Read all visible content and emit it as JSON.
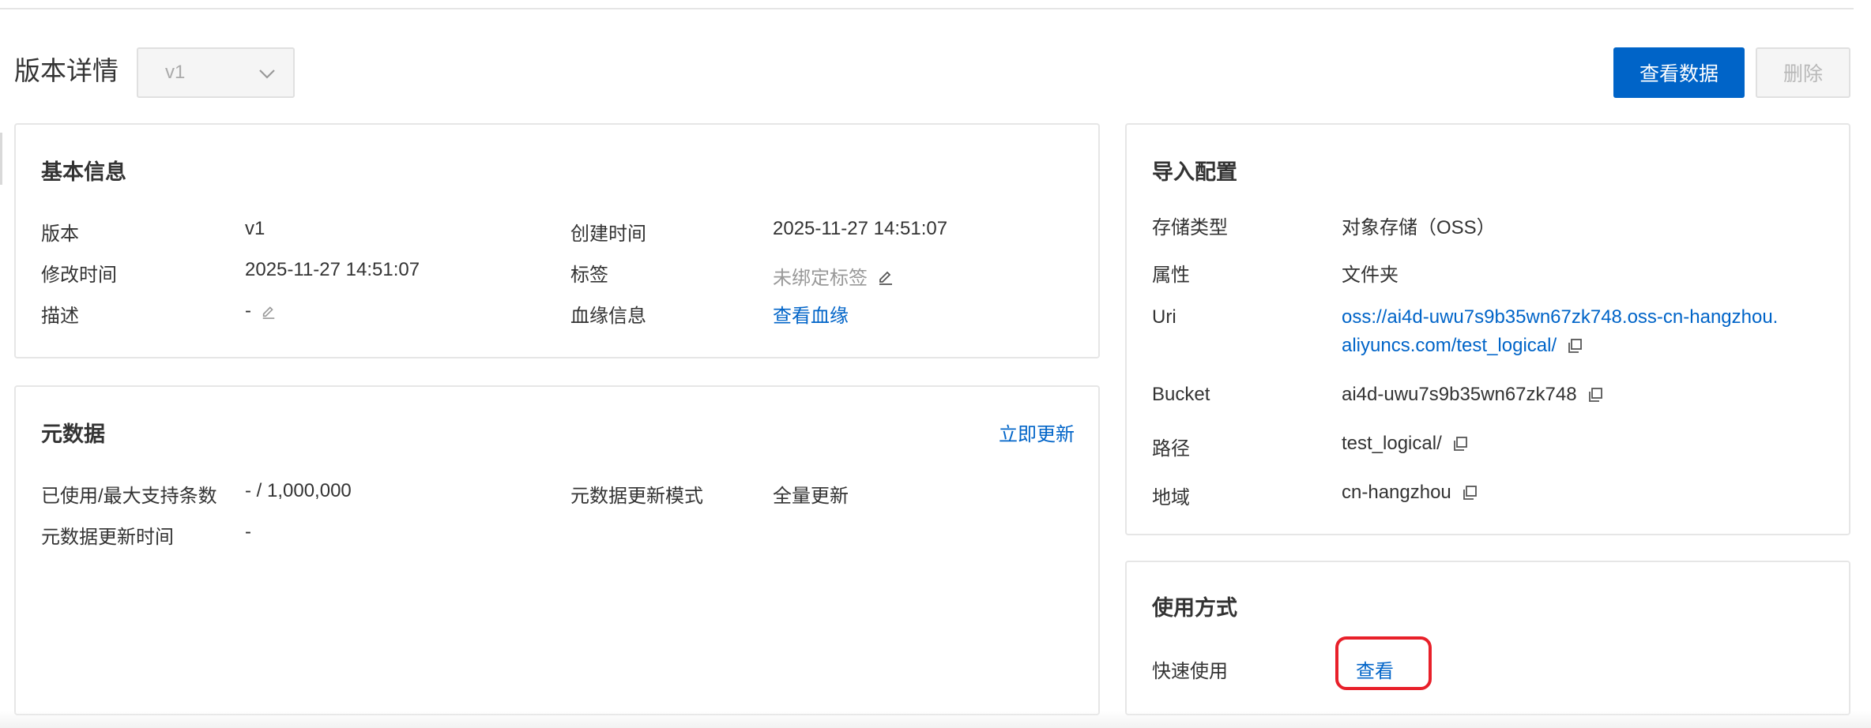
{
  "header": {
    "title": "版本详情",
    "version_selected": "v1",
    "view_data_label": "查看数据",
    "delete_label": "删除"
  },
  "basic_info": {
    "title": "基本信息",
    "version_label": "版本",
    "version_value": "v1",
    "created_label": "创建时间",
    "created_value": "2025-11-27 14:51:07",
    "modified_label": "修改时间",
    "modified_value": "2025-11-27 14:51:07",
    "tags_label": "标签",
    "tags_value": "未绑定标签",
    "desc_label": "描述",
    "desc_value": "-",
    "lineage_label": "血缘信息",
    "lineage_link": "查看血缘"
  },
  "metadata": {
    "title": "元数据",
    "update_now": "立即更新",
    "used_label": "已使用/最大支持条数",
    "used_value": "- / 1,000,000",
    "mode_label": "元数据更新模式",
    "mode_value": "全量更新",
    "update_time_label": "元数据更新时间",
    "update_time_value": "-"
  },
  "import_config": {
    "title": "导入配置",
    "storage_type_label": "存储类型",
    "storage_type_value": "对象存储（OSS）",
    "attr_label": "属性",
    "attr_value": "文件夹",
    "uri_label": "Uri",
    "uri_line1": "oss://ai4d-uwu7s9b35wn67zk748.oss-cn-hangzhou.",
    "uri_line2": "aliyuncs.com/test_logical/",
    "bucket_label": "Bucket",
    "bucket_value": "ai4d-uwu7s9b35wn67zk748",
    "path_label": "路径",
    "path_value": "test_logical/",
    "region_label": "地域",
    "region_value": "cn-hangzhou"
  },
  "usage": {
    "title": "使用方式",
    "quick_label": "快速使用",
    "view_link": "查看"
  },
  "colors": {
    "primary": "#0064c8",
    "highlight": "#e8202a"
  }
}
